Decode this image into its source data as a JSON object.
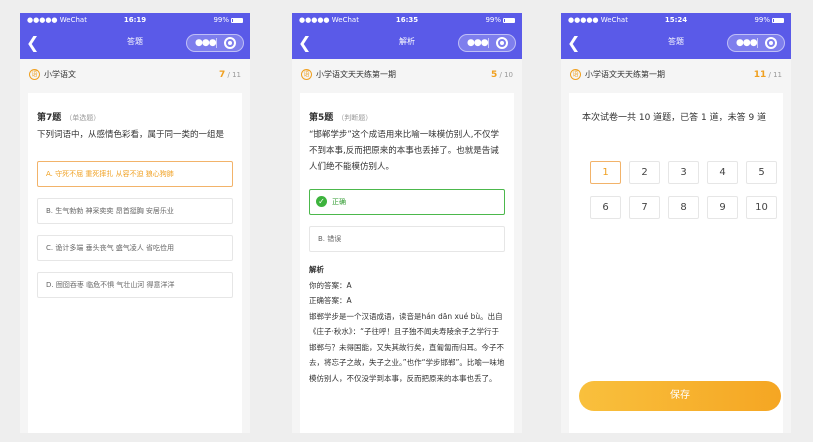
{
  "colors": {
    "nav_bg": "#5a5ae8",
    "accent": "#f0a020",
    "correct": "#3db33d"
  },
  "screens": [
    {
      "status": {
        "carrier": "●●●●● WeChat",
        "time": "16:19",
        "battery": "99%"
      },
      "nav_title": "答题",
      "paper_name": "小学语文",
      "progress_current": "7",
      "progress_total": "/ 11",
      "question_number": "第7题",
      "question_type": "（单选题）",
      "question_text": "下列词语中，从感情色彩看，属于同一类的一组是",
      "options": [
        "A. 守死不屈 重死摔扎 从容不迫 狼心狗肺",
        "B. 生气勃勃 神采奕奕 昂首挺胸 安居乐业",
        "C. 诡计多端 垂头丧气 盛气凌人 省吃俭用",
        "D. 囫囵吞枣 临危不惧 气壮山河 得意洋洋"
      ]
    },
    {
      "status": {
        "carrier": "●●●●● WeChat",
        "time": "16:35",
        "battery": "99%"
      },
      "nav_title": "解析",
      "paper_name": "小学语文天天练第一期",
      "progress_current": "5",
      "progress_total": "/ 10",
      "question_number": "第5题",
      "question_type": "（判断题）",
      "question_text": "“邯郸学步”这个成语用来比喻一味模仿别人,不仅学不到本事,反而把原来的本事也丢掉了。也就是告诫人们绝不能模仿别人。",
      "options": [
        "正确",
        "B. 错误"
      ],
      "analysis_title": "解析",
      "your_answer": "你的答案：A",
      "correct_answer": "正确答案：A",
      "analysis_text": "邯郸学步是一个汉语成语，读音是hán dān xué bù。出自《庄子·秋水》：“子往呼！且子独不闻夫寿陵余子之学行于邯郸与？未得国能，又失其故行矣，直匍匐而归耳。今子不去，将忘子之故，失子之业。”也作“学步邯郸”。比喻一味地模仿别人，不仅没学到本事，反而把原来的本事也丢了。"
    },
    {
      "status": {
        "carrier": "●●●●● WeChat",
        "time": "15:24",
        "battery": "99%"
      },
      "nav_title": "答题",
      "paper_name": "小学语文天天练第一期",
      "progress_current": "11",
      "progress_total": "/ 11",
      "summary": "本次试卷一共 10 道题，已答 1 道，未答 9 道",
      "numbers": [
        "1",
        "2",
        "3",
        "4",
        "5",
        "6",
        "7",
        "8",
        "9",
        "10"
      ],
      "save_label": "保存"
    }
  ]
}
